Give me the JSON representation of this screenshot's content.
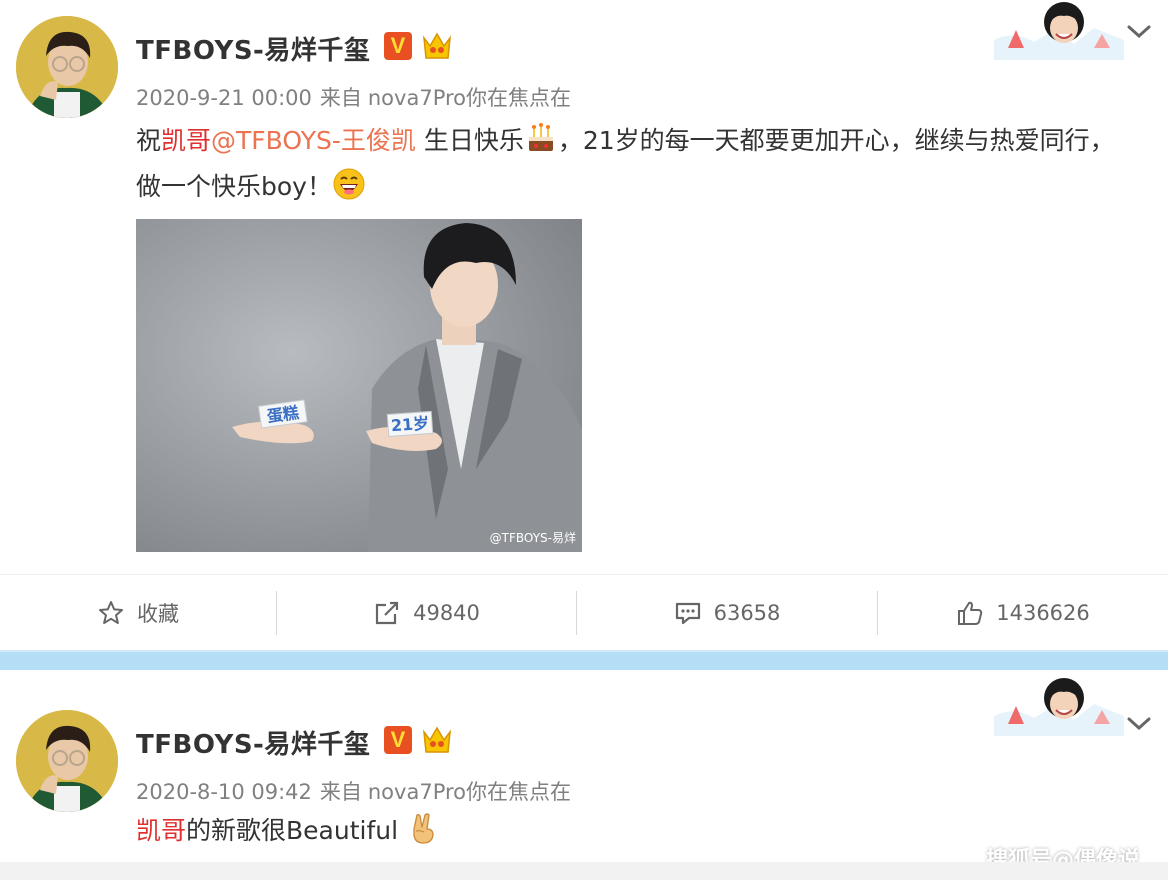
{
  "posts": [
    {
      "username": "TFBOYS-易烊千玺",
      "verified_label": "V",
      "timestamp": "2020-9-21 00:00",
      "source_prefix": "来自",
      "source_device": "nova7Pro你在焦点在",
      "text": {
        "prefix": "祝",
        "highlight": "凯哥",
        "mention": "@TFBOYS-王俊凯",
        "part1": " 生日快乐",
        "emoji1": "cake-emoji",
        "part2": "，21岁的每一天都要更加开心，继续与热爱同行，做一个快乐boy！",
        "emoji2": "laughing-emoji"
      },
      "image": {
        "card_left": "蛋糕",
        "card_right": "21岁",
        "watermark": "@TFBOYS-易烊"
      },
      "actions": {
        "favorite_label": "收藏",
        "repost_count": "49840",
        "comment_count": "63658",
        "like_count": "1436626"
      }
    },
    {
      "username": "TFBOYS-易烊千玺",
      "verified_label": "V",
      "timestamp": "2020-8-10 09:42",
      "source_prefix": "来自",
      "source_device": "nova7Pro你在焦点在",
      "text": {
        "highlight": "凯哥",
        "part1": "的新歌很Beautiful",
        "emoji1": "victory-hand-emoji"
      }
    }
  ],
  "source_tag": "搜狐号@偶像说",
  "colors": {
    "accent_red": "#e02f2f",
    "mention_orange": "#eb7350",
    "meta_gray": "#808080",
    "separator_blue": "#b4ddf6"
  }
}
